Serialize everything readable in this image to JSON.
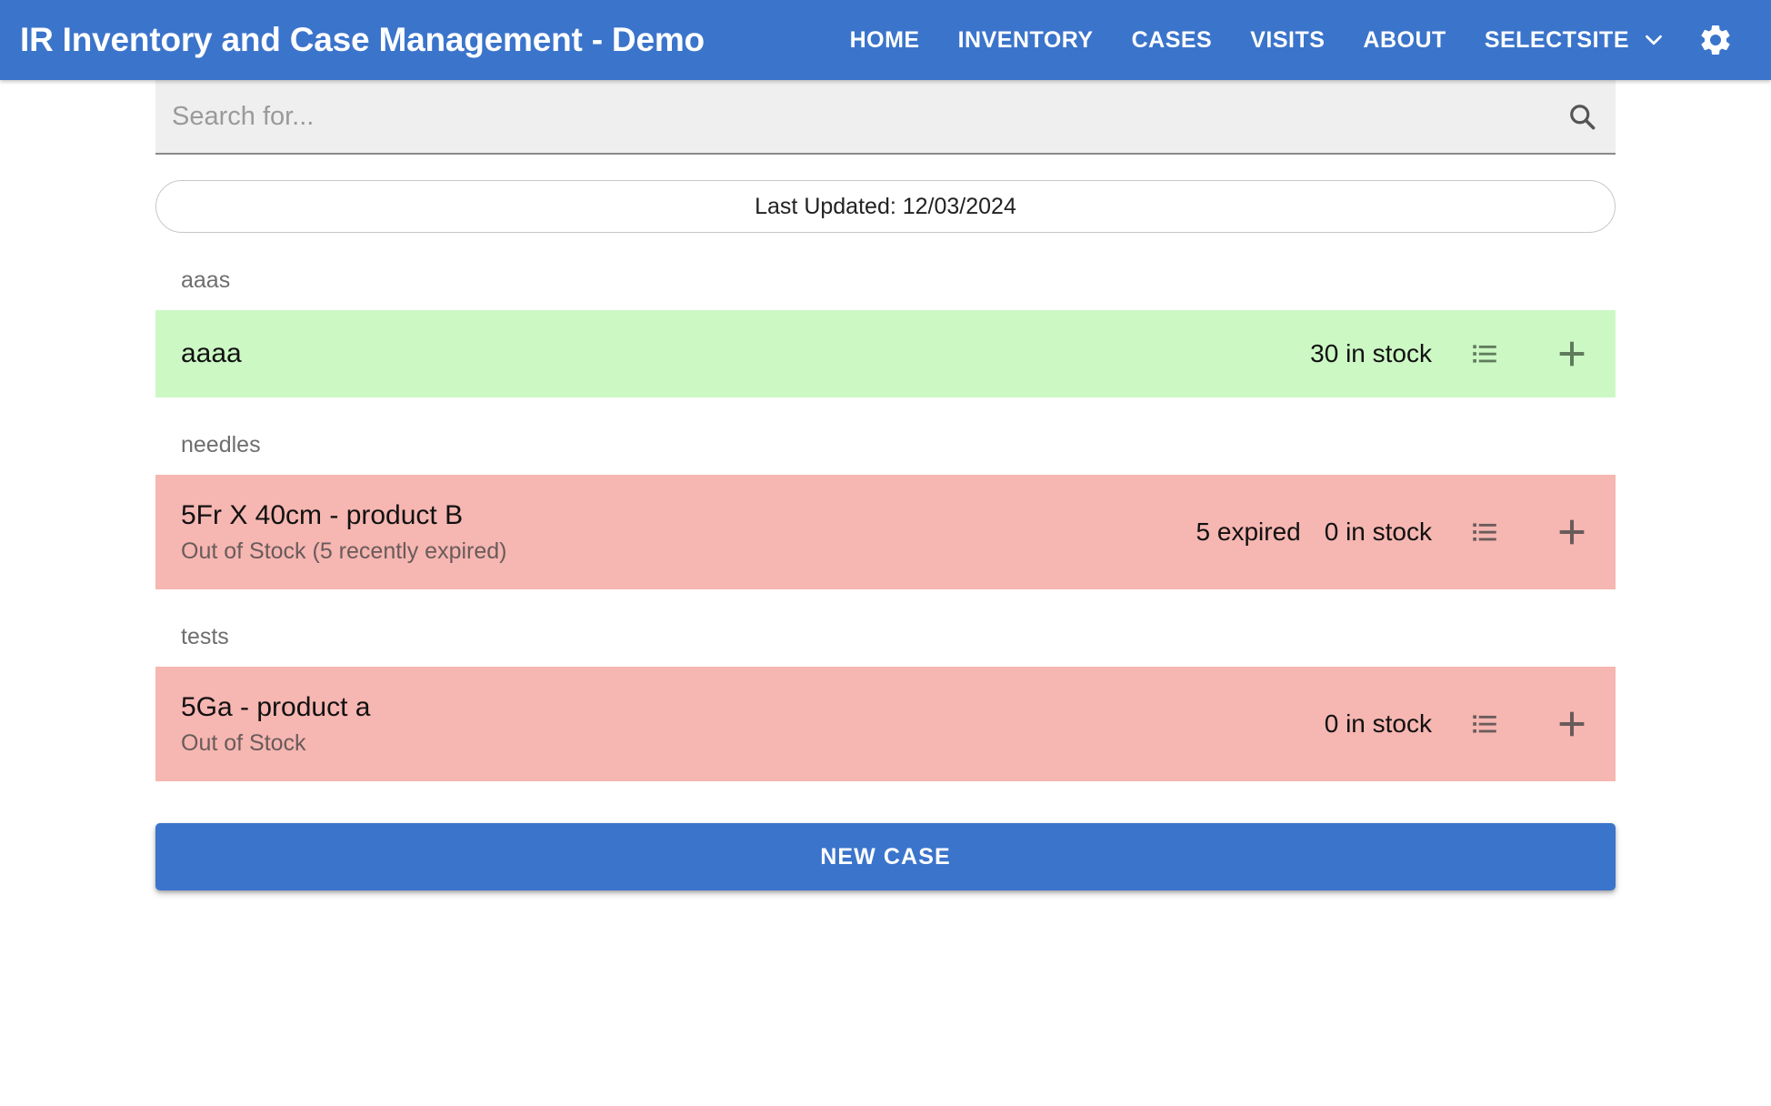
{
  "header": {
    "title": "IR Inventory and Case Management - Demo",
    "nav_items": [
      {
        "label": "HOME"
      },
      {
        "label": "INVENTORY"
      },
      {
        "label": "CASES"
      },
      {
        "label": "VISITS"
      },
      {
        "label": "ABOUT"
      },
      {
        "label": "SELECTSITE"
      }
    ],
    "dropdown_icon": "chevron-down-icon",
    "settings_icon": "gear-icon",
    "background_color": "#3b74cb",
    "text_color": "#ffffff"
  },
  "search": {
    "value": "",
    "placeholder": "Search for...",
    "icon": "search-icon"
  },
  "status": {
    "last_updated_label": "Last Updated: 12/03/2024"
  },
  "groups": [
    {
      "category": "aaas",
      "items": [
        {
          "title": "aaaa",
          "subtitle": "",
          "expired_text": "",
          "stock_text": "30 in stock",
          "state": "green",
          "color": "#ccf8c4",
          "list_icon": "list-icon",
          "add_icon": "plus-icon"
        }
      ]
    },
    {
      "category": "needles",
      "items": [
        {
          "title": "5Fr X 40cm - product B",
          "subtitle": "Out of Stock (5 recently expired)",
          "expired_text": "5 expired",
          "stock_text": "0 in stock",
          "state": "pink",
          "color": "#f6b6b1",
          "list_icon": "list-icon",
          "add_icon": "plus-icon"
        }
      ]
    },
    {
      "category": "tests",
      "items": [
        {
          "title": "5Ga - product a",
          "subtitle": "Out of Stock",
          "expired_text": "",
          "stock_text": "0 in stock",
          "state": "pink",
          "color": "#f6b6b1",
          "list_icon": "list-icon",
          "add_icon": "plus-icon"
        }
      ]
    }
  ],
  "footer": {
    "new_case_label": "NEW CASE",
    "new_case_color": "#3b74cb"
  }
}
